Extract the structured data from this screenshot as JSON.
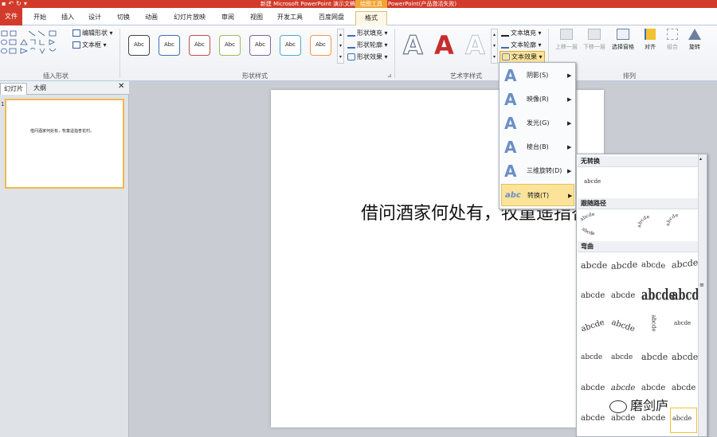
{
  "titlebar": {
    "title": "新建 Microsoft PowerPoint 演示文稿 - Microsoft PowerPoint(产品激活失败)",
    "context_tab": "绘图工具"
  },
  "tabs": [
    "文件",
    "开始",
    "插入",
    "设计",
    "切换",
    "动画",
    "幻灯片放映",
    "审阅",
    "视图",
    "开发工具",
    "百度网盘",
    "格式"
  ],
  "ribbon": {
    "insert_shapes": {
      "label": "插入形状",
      "edit_shape": "编辑形状",
      "text_box": "文本框"
    },
    "shape_styles": {
      "label": "形状样式",
      "swatch_text": "Abc",
      "swatch_colors": [
        "#222222",
        "#3f6fb5",
        "#c0504d",
        "#9bbb59",
        "#8064a2",
        "#4bacc6",
        "#f79646"
      ],
      "fill": "形状填充",
      "outline": "形状轮廓",
      "effects": "形状效果"
    },
    "wordart": {
      "label": "艺术字样式",
      "letter": "A",
      "text_fill": "文本填充",
      "text_outline": "文本轮廓",
      "text_effects": "文本效果"
    },
    "arrange": {
      "label": "排列",
      "bring_forward": "上移一层",
      "send_backward": "下移一层",
      "selection_pane": "选择窗格",
      "align": "对齐",
      "group": "组合",
      "rotate": "旋转"
    }
  },
  "left_pane": {
    "tab_slides": "幻灯片",
    "tab_outline": "大纲",
    "slide_number": "1",
    "thumb_text": "借问酒家何处有，牧童遥指杏花村。"
  },
  "slide": {
    "text": "借问酒家何处有，牧童遥指杏花村。"
  },
  "effects_menu": [
    {
      "icon": "A",
      "label": "阴影(S)",
      "selected": false
    },
    {
      "icon": "A",
      "label": "映像(R)",
      "selected": false
    },
    {
      "icon": "A",
      "label": "发光(G)",
      "selected": false
    },
    {
      "icon": "A",
      "label": "棱台(B)",
      "selected": false
    },
    {
      "icon": "A",
      "label": "三维旋转(D)",
      "selected": false
    },
    {
      "icon": "abc",
      "label": "转换(T)",
      "selected": true
    }
  ],
  "transform_gallery": {
    "no_transform": "无转换",
    "no_transform_sample": "abcde",
    "follow_path": "跟随路径",
    "warp": "弯曲",
    "path_samples": [
      "abcde",
      "abcde",
      "abcde",
      "abcde"
    ],
    "warp_samples": [
      "abcde",
      "abcde",
      "abcde",
      "abcde",
      "abcde",
      "abcde",
      "abcde",
      "abcde",
      "abcde",
      "abcde",
      "abcde",
      "abcde",
      "abcde",
      "abcde",
      "abcde",
      "abcde",
      "abcde",
      "abcde",
      "abcde",
      "abcde",
      "abcde",
      "abcde",
      "abcde",
      "abcde"
    ]
  },
  "watermark": "磨剑庐"
}
